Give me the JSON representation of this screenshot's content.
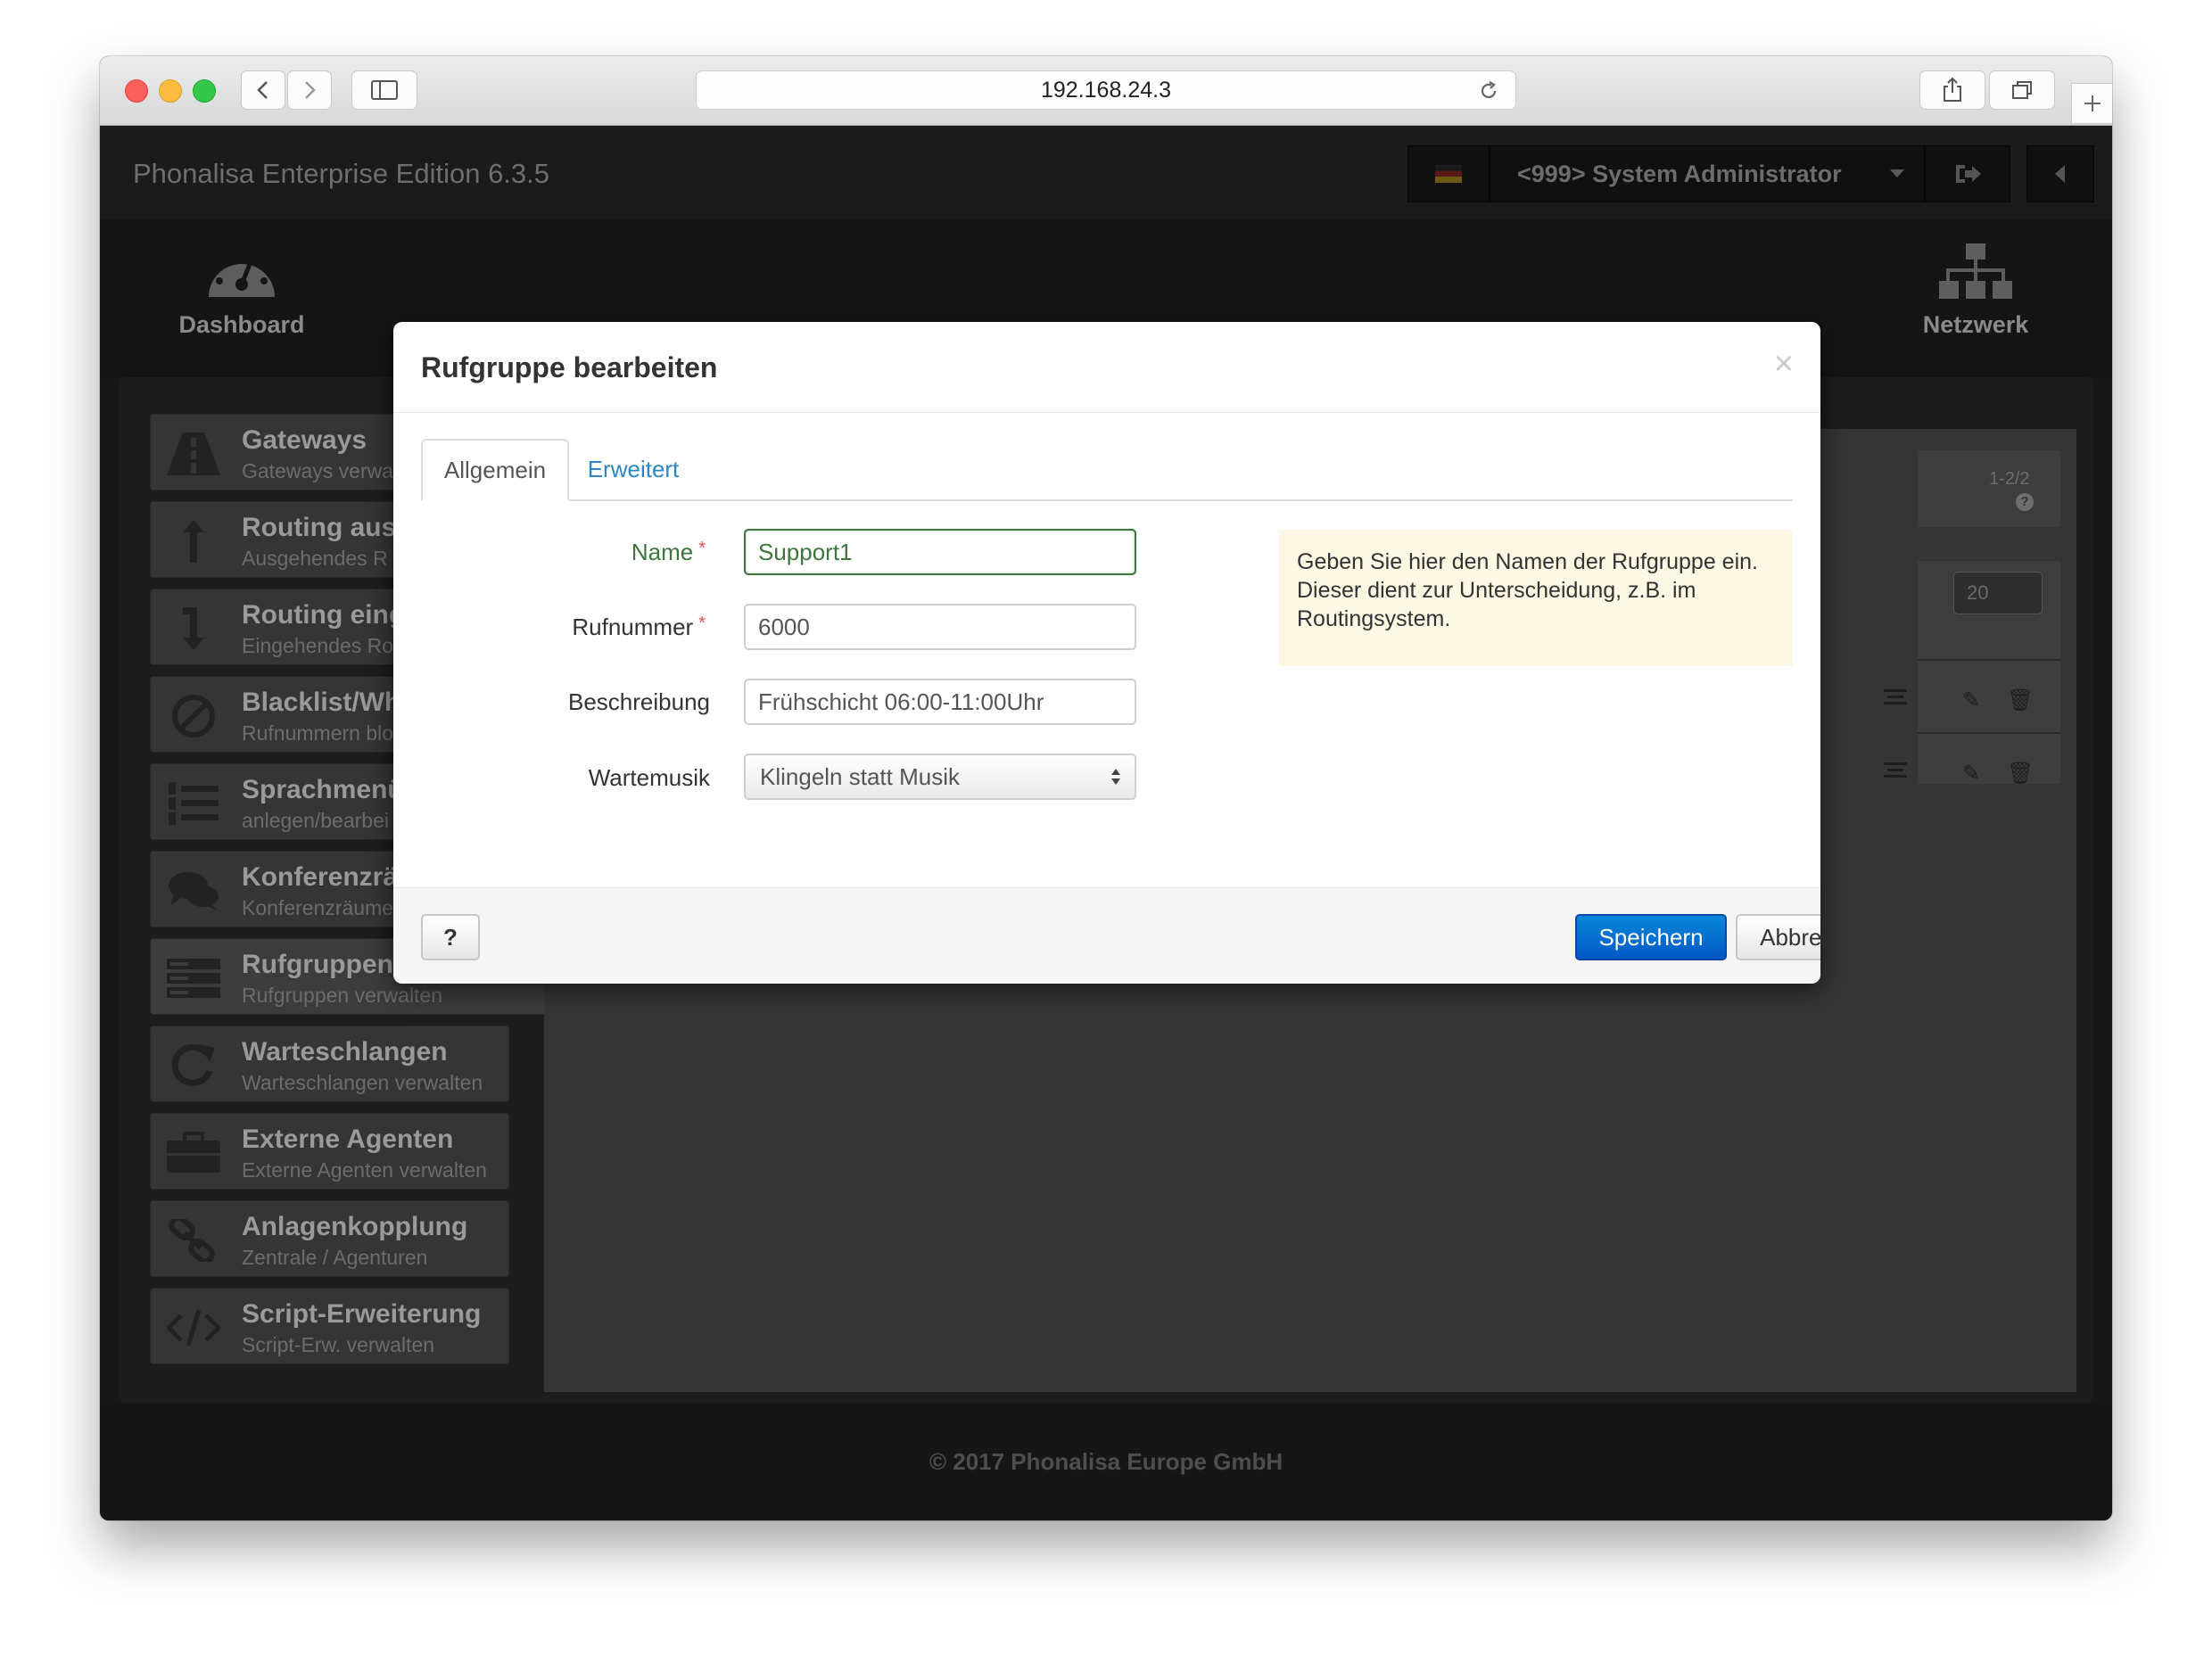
{
  "browser": {
    "url": "192.168.24.3"
  },
  "app": {
    "title": "Phonalisa Enterprise Edition 6.3.5",
    "user": "<999> System Administrator",
    "footer": "© 2017 Phonalisa Europe GmbH"
  },
  "iconbar": {
    "left_label": "Dashboard",
    "right_label": "Netzwerk"
  },
  "sidebar": {
    "items": [
      {
        "title": "Gateways",
        "subtitle": "Gateways verwa"
      },
      {
        "title": "Routing aus",
        "subtitle": "Ausgehendes R"
      },
      {
        "title": "Routing eing",
        "subtitle": "Eingehendes Ro"
      },
      {
        "title": "Blacklist/Wh",
        "subtitle": "Rufnummern blo"
      },
      {
        "title": "Sprachmenü",
        "subtitle": "anlegen/bearbei"
      },
      {
        "title": "Konferenzrä",
        "subtitle": "Konferenzräume"
      },
      {
        "title": "Rufgruppen",
        "subtitle": "Rufgruppen verwalten"
      },
      {
        "title": "Warteschlangen",
        "subtitle": "Warteschlangen verwalten"
      },
      {
        "title": "Externe Agenten",
        "subtitle": "Externe Agenten verwalten"
      },
      {
        "title": "Anlagenkopplung",
        "subtitle": "Zentrale / Agenturen"
      },
      {
        "title": "Script-Erweiterung",
        "subtitle": "Script-Erw. verwalten"
      }
    ]
  },
  "main": {
    "pagination": "1-2/2",
    "per_page": "20"
  },
  "modal": {
    "title": "Rufgruppe bearbeiten",
    "close_symbol": "×",
    "tabs": [
      {
        "label": "Allgemein"
      },
      {
        "label": "Erweitert"
      }
    ],
    "required_mark": "*",
    "fields": {
      "name_label": "Name",
      "name_value": "Support1",
      "number_label": "Rufnummer",
      "number_value": "6000",
      "description_label": "Beschreibung",
      "description_value": "Frühschicht 06:00-11:00Uhr",
      "music_label": "Wartemusik",
      "music_value": "Klingeln statt Musik"
    },
    "hint": "Geben Sie hier den Namen der Rufgruppe ein. Dieser dient zur Unterscheidung, z.B. im Routingsystem.",
    "help_button": "?",
    "save_button": "Speichern",
    "cancel_button": "Abbrechen"
  }
}
